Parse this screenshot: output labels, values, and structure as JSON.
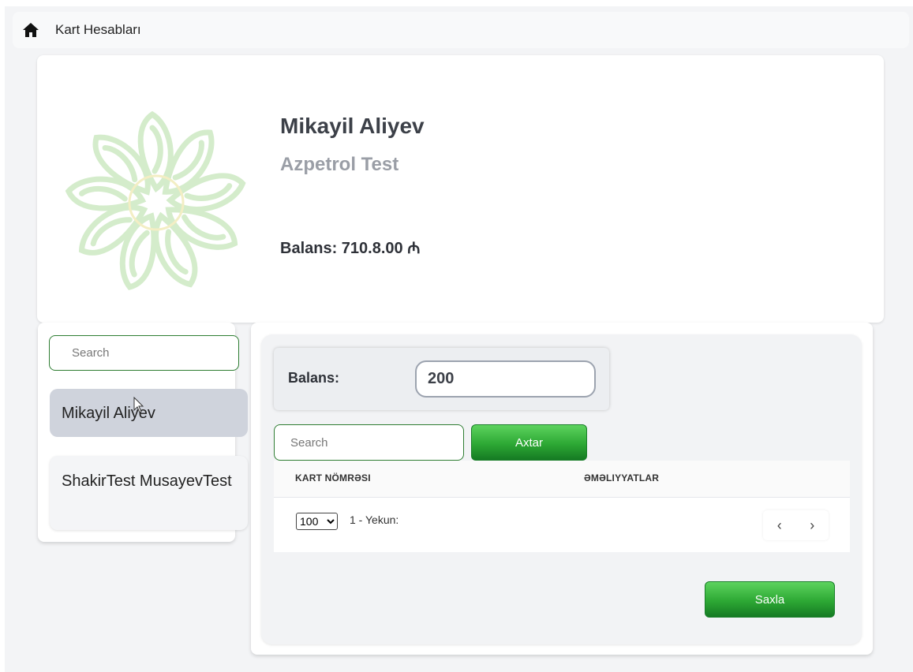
{
  "topbar": {
    "title": "Kart Hesabları"
  },
  "profile": {
    "name": "Mikayil Aliyev",
    "company": "Azpetrol Test",
    "balance_text": "Balans: 710.8.00 ₼"
  },
  "users": {
    "search_placeholder": "Search",
    "items": [
      {
        "label": "Mikayil Aliyev",
        "active": true
      },
      {
        "label": "ShakirTest MusayevTest",
        "active": false
      }
    ]
  },
  "balance_form": {
    "label": "Balans:",
    "value": "200"
  },
  "card_search": {
    "placeholder": "Search",
    "button_label": "Axtar"
  },
  "table": {
    "columns": [
      "KART NÖMRƏSI",
      "ƏMƏLIYYATLAR"
    ],
    "rows": [],
    "per_page": "100",
    "page_info": "1 - Yekun:",
    "prev": "‹",
    "next": "›"
  },
  "save_button": {
    "label": "Saxla"
  },
  "colors": {
    "accent_green": "#2da834",
    "active_item": "#cfd3dc"
  }
}
